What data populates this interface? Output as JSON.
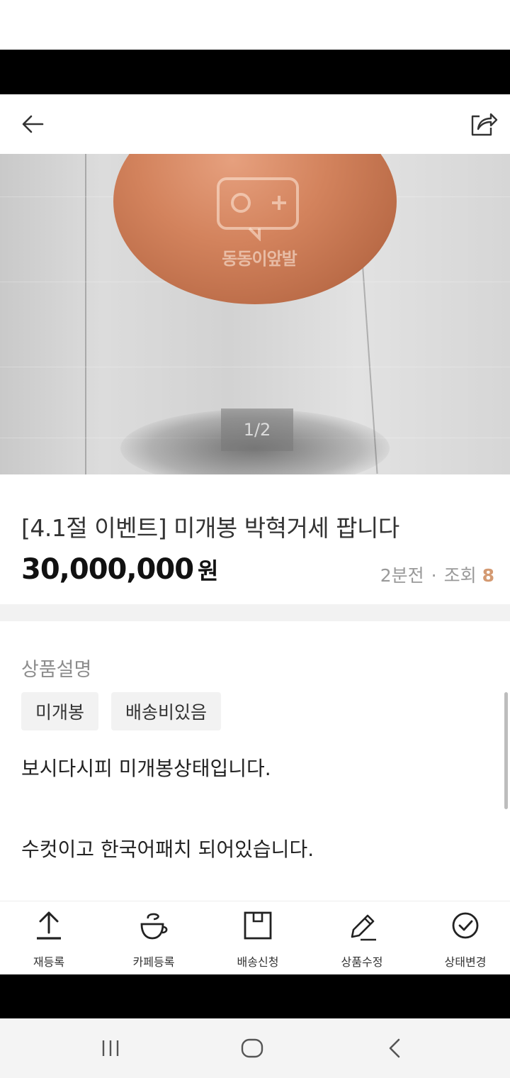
{
  "product": {
    "title": "[4.1절 이벤트] 미개봉 박혁거세 팝니다",
    "price": "30,000,000",
    "price_unit": "원",
    "posted_ago": "2분전",
    "views_label": "조회",
    "views_count": "8"
  },
  "gallery": {
    "indicator": "1/2",
    "watermark_text": "동동이앞발"
  },
  "description": {
    "label": "상품설명",
    "tags": [
      "미개봉",
      "배송비있음"
    ],
    "lines": [
      "보시다시피 미개봉상태입니다.",
      "수컷이고 한국어패치 되어있습니다."
    ]
  },
  "bottom_actions": [
    {
      "label": "재등록",
      "icon": "upload-icon"
    },
    {
      "label": "카페등록",
      "icon": "cup-icon"
    },
    {
      "label": "배송신청",
      "icon": "box-icon"
    },
    {
      "label": "상품수정",
      "icon": "pencil-icon"
    },
    {
      "label": "상태변경",
      "icon": "check-circle-icon"
    }
  ],
  "colors": {
    "accent_views": "#d49a72",
    "meta_text": "#999999",
    "tag_bg": "#f2f2f2"
  }
}
